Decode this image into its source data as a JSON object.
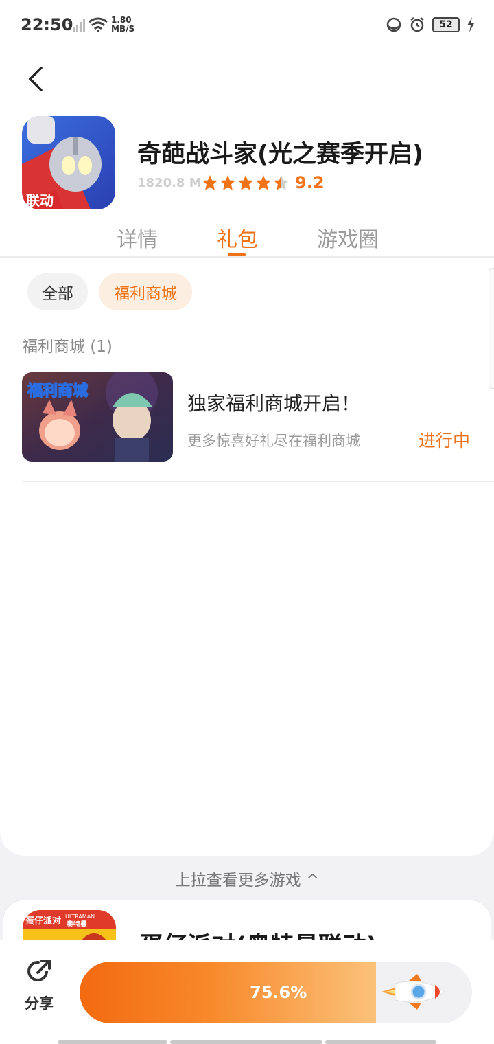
{
  "status_bar": {
    "time": "22:50",
    "speed_value": "1.80",
    "speed_unit": "MB/S",
    "battery": "52"
  },
  "app": {
    "title": "奇葩战斗家(光之赛季开启)",
    "size": "1820.8 M",
    "rating": "9.2",
    "stars": 4.5,
    "icon_badge": "联动"
  },
  "tabs": [
    {
      "label": "详情"
    },
    {
      "label": "礼包"
    },
    {
      "label": "游戏圈"
    }
  ],
  "active_tab": "礼包",
  "filters": {
    "all": "全部",
    "mall": "福利商城"
  },
  "section": {
    "title": "福利商城 (1)"
  },
  "gift": {
    "thumb_text": "福利商城",
    "title": "独家福利商城开启！",
    "subtitle": "更多惊喜好礼尽在福利商城",
    "status": "进行中"
  },
  "pull_more": "上拉查看更多游戏 ^",
  "next_game": {
    "title": "蛋仔派对(奥特曼联动)",
    "icon_text_1": "蛋仔派对",
    "icon_text_2": "ULTRAMAN",
    "icon_text_3": "奥特曼"
  },
  "bottom": {
    "share_label": "分享",
    "progress_label": "75.6%",
    "progress_fraction": 0.756
  },
  "colors": {
    "accent": "#f07318",
    "chip_bg": "#fdeee2"
  }
}
